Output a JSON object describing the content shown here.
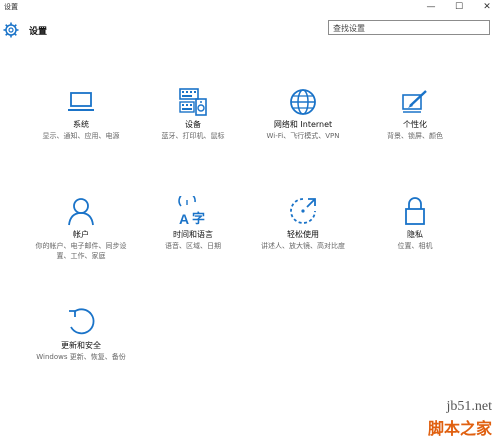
{
  "window": {
    "title": "设置",
    "minimize": "—",
    "maximize": "☐",
    "close": "✕"
  },
  "header": {
    "title": "设置",
    "search_placeholder": "查找设置"
  },
  "tiles": [
    {
      "title": "系统",
      "desc": "显示、通知、应用、电源"
    },
    {
      "title": "设备",
      "desc": "蓝牙、打印机、鼠标"
    },
    {
      "title": "网络和 Internet",
      "desc": "Wi-Fi、飞行模式、VPN"
    },
    {
      "title": "个性化",
      "desc": "背景、锁屏、颜色"
    },
    {
      "title": "帐户",
      "desc": "你的帐户、电子邮件、同步设置、工作、家庭"
    },
    {
      "title": "时间和语言",
      "desc": "语音、区域、日期"
    },
    {
      "title": "轻松使用",
      "desc": "讲述人、放大镜、高对比度"
    },
    {
      "title": "隐私",
      "desc": "位置、相机"
    },
    {
      "title": "更新和安全",
      "desc": "Windows 更新、恢复、备份"
    }
  ],
  "watermark": {
    "line1": "jb51.net",
    "line2": "脚本之家"
  },
  "colors": {
    "accent": "#1a73c8"
  }
}
